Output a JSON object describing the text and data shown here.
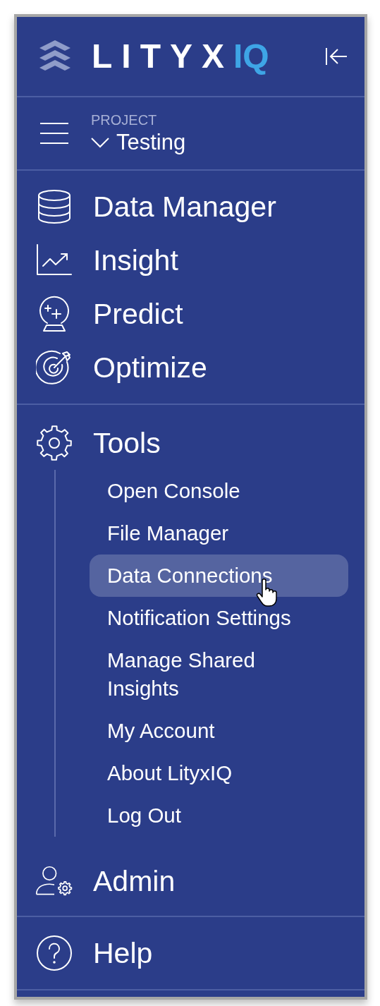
{
  "logo": {
    "text": "LITYX",
    "accent": "IQ"
  },
  "project": {
    "label": "PROJECT",
    "name": "Testing"
  },
  "main_items": [
    {
      "label": "Data Manager"
    },
    {
      "label": "Insight"
    },
    {
      "label": "Predict"
    },
    {
      "label": "Optimize"
    }
  ],
  "tools": {
    "label": "Tools",
    "expanded": true,
    "children": [
      {
        "label": "Open Console",
        "selected": false
      },
      {
        "label": "File Manager",
        "selected": false
      },
      {
        "label": "Data Connections",
        "selected": true
      },
      {
        "label": "Notification Settings",
        "selected": false
      },
      {
        "label": "Manage Shared Insights",
        "selected": false
      },
      {
        "label": "My Account",
        "selected": false
      },
      {
        "label": "About LityxIQ",
        "selected": false
      },
      {
        "label": "Log Out",
        "selected": false
      }
    ]
  },
  "admin": {
    "label": "Admin"
  },
  "help": {
    "label": "Help"
  }
}
